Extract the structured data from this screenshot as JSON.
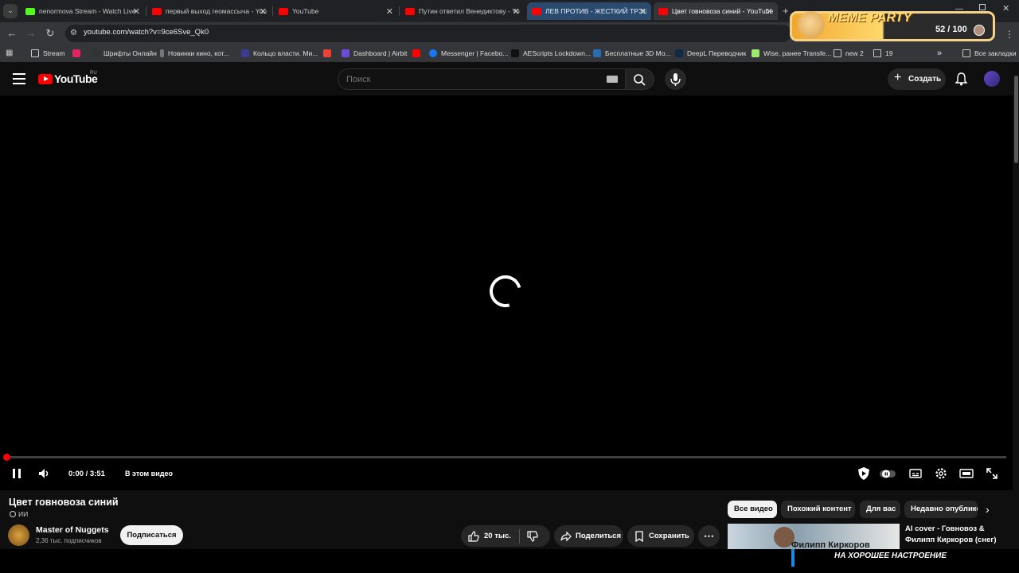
{
  "browser": {
    "tabs": [
      {
        "title": "nenormova Stream - Watch Live",
        "favicon_color": "#53fc18",
        "close": "✕"
      },
      {
        "title": "первый выход геомассыча - YouTube",
        "favicon_color": "#ff0000",
        "close": "✕"
      },
      {
        "title": "YouTube",
        "favicon_color": "#ff0000",
        "close": "✕"
      },
      {
        "title": "Путин ответил Венедиктову - YouTube",
        "favicon_color": "#ff0000",
        "close": "✕"
      },
      {
        "title": "ЛЕВ ПРОТИВ - ЖЕСТКИЙ ТРЭШ",
        "favicon_color": "#ff0000",
        "close": "✕"
      },
      {
        "title": "Цвет говновоза синий - YouTube",
        "favicon_color": "#ff0000",
        "close": "✕"
      }
    ],
    "new_tab": "+",
    "url": "youtube.com/watch?v=9ce6Sve_Qk0",
    "bookmarks": [
      {
        "label": "Stream",
        "icon": "folder-icon"
      },
      {
        "label": "",
        "icon": "app-icon",
        "color": "#e0245e"
      },
      {
        "label": "Шрифты Онлайн",
        "icon": "font-icon"
      },
      {
        "label": "Новинки кино, кот...",
        "icon": "bottle-icon"
      },
      {
        "label": "Кольцо власти. Ми...",
        "icon": "r-icon",
        "color": "#3b3b8f"
      },
      {
        "label": "",
        "icon": "gmail-icon",
        "color": "#ea4335"
      },
      {
        "label": "Dashboard | Airbit",
        "icon": "airbit-icon",
        "color": "#6b4bd8"
      },
      {
        "label": "",
        "icon": "youtube-icon",
        "color": "#ff0000"
      },
      {
        "label": "Messenger | Facebo...",
        "icon": "facebook-icon",
        "color": "#1877f2"
      },
      {
        "label": "AEScripts Lockdown...",
        "icon": "tiktok-icon"
      },
      {
        "label": "Бесплатные 3D Мо...",
        "icon": "3d-icon",
        "color": "#2b6cb0"
      },
      {
        "label": "DeepL Переводчик",
        "icon": "deepl-icon"
      },
      {
        "label": "Wise, ранее Transfe...",
        "icon": "wise-icon",
        "color": "#9fe870"
      },
      {
        "label": "new 2",
        "icon": "folder-icon"
      },
      {
        "label": "19",
        "icon": "folder-icon"
      }
    ],
    "bookmarks_overflow": "»",
    "all_bookmarks": "Все закладки"
  },
  "meme_party": {
    "title": "MEME PARTY",
    "count": "52 / 100"
  },
  "youtube": {
    "logo": "YouTube",
    "region": "RU",
    "search_placeholder": "Поиск",
    "create_label": "Создать",
    "player": {
      "time": "0:00 / 3:51",
      "in_this_video": "В этом видео",
      "progress": 0.0
    },
    "video": {
      "title": "Цвет говновоза синий",
      "ai_badge": "ИИ",
      "channel": "Master of Nuggets",
      "subscribers": "2,36 тыс. подписчиков",
      "subscribe": "Подписаться",
      "likes": "20 тыс.",
      "share": "Поделиться",
      "save": "Сохранить",
      "more": "⋯"
    },
    "chips": [
      "Все видео",
      "Похожий контент",
      "Для вас",
      "Недавно опублико"
    ],
    "recommendation": {
      "title_line1": "AI cover - Говновоз &",
      "title_line2": "Филипп Киркоров (снег)",
      "thumb_text": "Филипп Киркоров"
    },
    "overlay_caption": "НА ХОРОШЕЕ НАСТРОЕНИЕ"
  },
  "colors": {
    "accent_red": "#ff0000",
    "background": "#0f0f0f",
    "chip_selected": "#f1f1f1"
  }
}
